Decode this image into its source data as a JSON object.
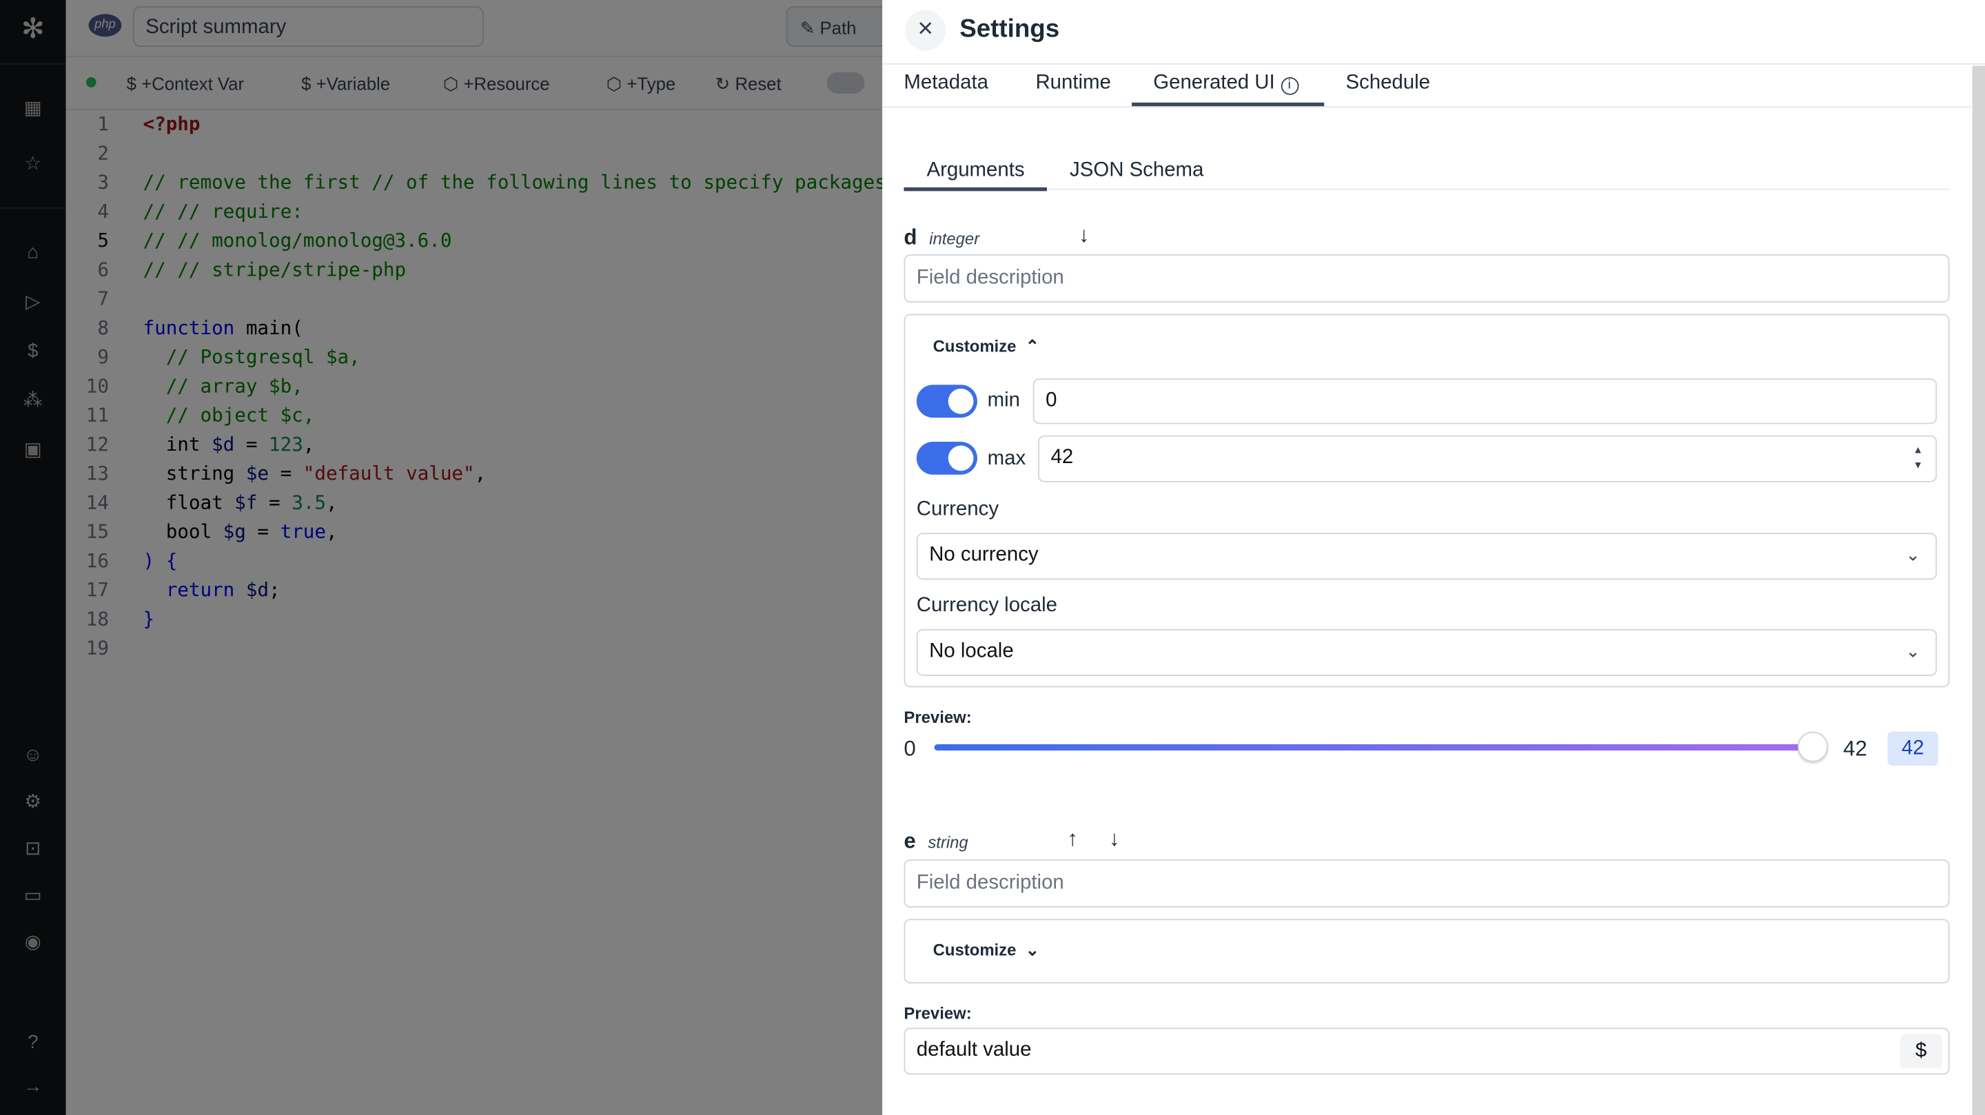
{
  "sidebar": {
    "icons": [
      "windmill-logo-icon",
      "building-icon",
      "star-icon",
      "home-icon",
      "play-icon",
      "dollar-icon",
      "resources-icon",
      "calendar-icon",
      "user-icon",
      "gear-icon",
      "robot-icon",
      "folder-icon",
      "eye-icon",
      "help-icon",
      "expand-arrow-icon"
    ]
  },
  "editor": {
    "language_badge": "php",
    "summary_placeholder": "Script summary",
    "path_label": "Path",
    "toolbar": [
      "+Context Var",
      "+Variable",
      "+Resource",
      "+Type",
      "Reset"
    ],
    "current_line": 5,
    "lines": [
      [
        [
          "<?php",
          "tag"
        ]
      ],
      [],
      [
        [
          "// remove the first // of the following lines to specify packages",
          "c"
        ]
      ],
      [
        [
          "// // require:",
          "c"
        ]
      ],
      [
        [
          "// // monolog/monolog@3.6.0",
          "c"
        ]
      ],
      [
        [
          "// // stripe/stripe-php",
          "c"
        ]
      ],
      [],
      [
        [
          "function",
          "k"
        ],
        [
          " main(",
          "p"
        ]
      ],
      [
        [
          "  // Postgresql $a,",
          "c"
        ]
      ],
      [
        [
          "  // array $b,",
          "c"
        ]
      ],
      [
        [
          "  // object $c,",
          "c"
        ]
      ],
      [
        [
          "  int ",
          "p"
        ],
        [
          "$d",
          "v"
        ],
        [
          " = ",
          "p"
        ],
        [
          "123",
          "n"
        ],
        [
          ",",
          "p"
        ]
      ],
      [
        [
          "  string ",
          "p"
        ],
        [
          "$e",
          "v"
        ],
        [
          " = ",
          "p"
        ],
        [
          "\"default value\"",
          "s"
        ],
        [
          ",",
          "p"
        ]
      ],
      [
        [
          "  float ",
          "p"
        ],
        [
          "$f",
          "v"
        ],
        [
          " = ",
          "p"
        ],
        [
          "3.5",
          "n"
        ],
        [
          ",",
          "p"
        ]
      ],
      [
        [
          "  bool ",
          "p"
        ],
        [
          "$g",
          "v"
        ],
        [
          " = ",
          "p"
        ],
        [
          "true",
          "k"
        ],
        [
          ",",
          "p"
        ]
      ],
      [
        [
          ") {",
          "k"
        ]
      ],
      [
        [
          "  return ",
          "k"
        ],
        [
          "$d",
          "v"
        ],
        [
          ";",
          "p"
        ]
      ],
      [
        [
          "}",
          "k"
        ]
      ],
      []
    ]
  },
  "settings": {
    "title": "Settings",
    "tabs": [
      "Metadata",
      "Runtime",
      "Generated UI",
      "Schedule"
    ],
    "active_tab": "Generated UI",
    "subtabs": [
      "Arguments",
      "JSON Schema"
    ],
    "active_subtab": "Arguments",
    "fields": {
      "d": {
        "name": "d",
        "type": "integer",
        "description_placeholder": "Field description",
        "customize_label": "Customize",
        "min_label": "min",
        "min_enabled": true,
        "min_value": "0",
        "max_label": "max",
        "max_enabled": true,
        "max_value": "42",
        "currency_label": "Currency",
        "currency_value": "No currency",
        "locale_label": "Currency locale",
        "locale_value": "No locale",
        "preview_label": "Preview:",
        "slider_min": "0",
        "slider_max": "42",
        "slider_value": "42"
      },
      "e": {
        "name": "e",
        "type": "string",
        "description_placeholder": "Field description",
        "customize_label": "Customize",
        "preview_label": "Preview:",
        "preview_value": "default value",
        "dollar": "$"
      }
    },
    "colors": {
      "accent": "#3b6ee8",
      "slider_start": "#3b6ee8",
      "slider_end": "#a56cf0"
    }
  }
}
